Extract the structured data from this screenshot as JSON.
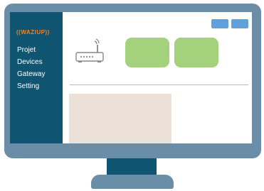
{
  "app": {
    "logo_text": "WAZIUP",
    "logo_left_mark": "((",
    "logo_right_mark": "))"
  },
  "sidebar": {
    "items": [
      {
        "label": "Projet"
      },
      {
        "label": "Devices"
      },
      {
        "label": "Gateway"
      },
      {
        "label": "Setting"
      }
    ]
  },
  "icons": {
    "gateway": "router-icon"
  },
  "colors": {
    "sidebar": "#0f5470",
    "monitor": "#6b8ea8",
    "accent_buttons": "#5ea1dc",
    "cards": "#a3d17c",
    "panel": "#ece1d7",
    "logo": "#f58220"
  }
}
